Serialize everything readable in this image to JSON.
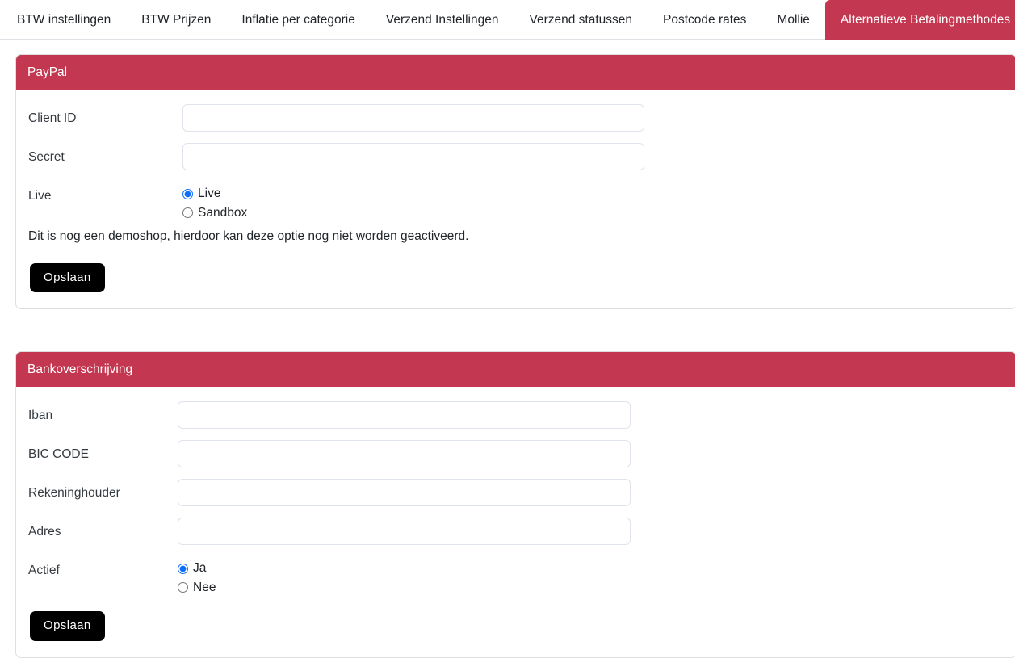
{
  "tabs": [
    {
      "label": "BTW instellingen",
      "active": false
    },
    {
      "label": "BTW Prijzen",
      "active": false
    },
    {
      "label": "Inflatie per categorie",
      "active": false
    },
    {
      "label": "Verzend Instellingen",
      "active": false
    },
    {
      "label": "Verzend statussen",
      "active": false
    },
    {
      "label": "Postcode rates",
      "active": false
    },
    {
      "label": "Mollie",
      "active": false
    },
    {
      "label": "Alternatieve Betalingmethodes",
      "active": true
    }
  ],
  "colors": {
    "accent": "#c33750",
    "button": "#000000",
    "radio_accent": "#0d6efd",
    "border": "#dfdfdf",
    "input_border": "#dfe3ea"
  },
  "paypal": {
    "title": "PayPal",
    "fields": {
      "client_id_label": "Client ID",
      "client_id_value": "",
      "client_id_placeholder": "",
      "secret_label": "Secret",
      "secret_value": "",
      "secret_placeholder": "",
      "live_label": "Live"
    },
    "radios": [
      {
        "label": "Live",
        "checked": true
      },
      {
        "label": "Sandbox",
        "checked": false
      }
    ],
    "note": "Dit is nog een demoshop, hierdoor kan deze optie nog niet worden geactiveerd.",
    "save_label": "Opslaan"
  },
  "bank": {
    "title": "Bankoverschrijving",
    "fields": {
      "iban_label": "Iban",
      "iban_value": "",
      "iban_placeholder": "",
      "bic_label": "BIC CODE",
      "bic_value": "",
      "bic_placeholder": "",
      "holder_label": "Rekeninghouder",
      "holder_value": "",
      "holder_placeholder": "",
      "address_label": "Adres",
      "address_value": "",
      "address_placeholder": "",
      "active_label": "Actief"
    },
    "radios": [
      {
        "label": "Ja",
        "checked": true
      },
      {
        "label": "Nee",
        "checked": false
      }
    ],
    "save_label": "Opslaan"
  }
}
